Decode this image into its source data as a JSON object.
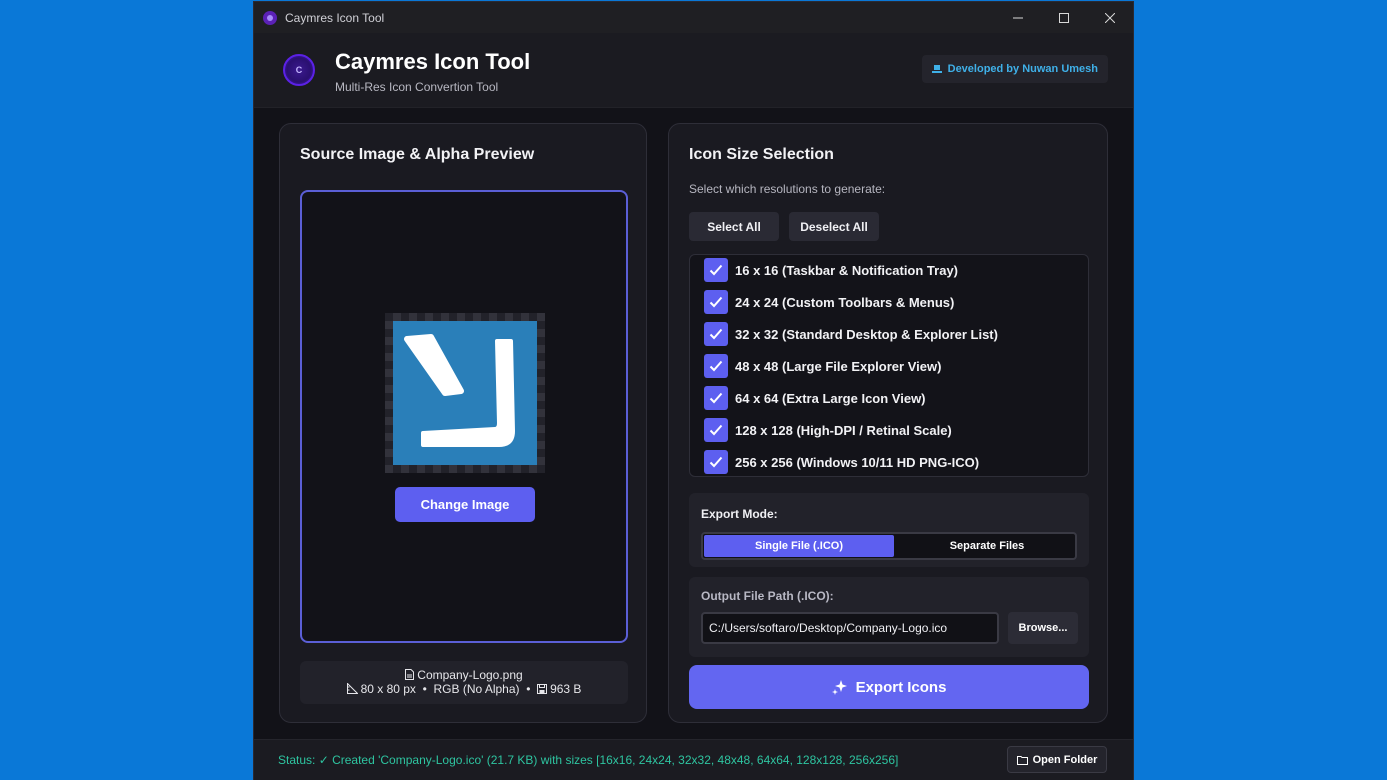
{
  "window": {
    "title": "Caymres Icon Tool"
  },
  "header": {
    "logo_letter": "C",
    "app_name": "Caymres Icon Tool",
    "subtitle": "Multi-Res Icon Convertion Tool",
    "developer_badge": "Developed by Nuwan Umesh"
  },
  "source_panel": {
    "title": "Source Image & Alpha Preview",
    "change_button": "Change Image",
    "file_name": "Company-Logo.png",
    "dimensions": "80 x 80 px",
    "color_mode": "RGB (No Alpha)",
    "file_size": "963 B",
    "separator": "•"
  },
  "size_panel": {
    "title": "Icon Size Selection",
    "hint": "Select which resolutions to generate:",
    "select_all": "Select All",
    "deselect_all": "Deselect All",
    "sizes": [
      {
        "label": "16 x 16 (Taskbar & Notification Tray)",
        "checked": true
      },
      {
        "label": "24 x 24 (Custom Toolbars & Menus)",
        "checked": true
      },
      {
        "label": "32 x 32 (Standard Desktop & Explorer List)",
        "checked": true
      },
      {
        "label": "48 x 48 (Large File Explorer View)",
        "checked": true
      },
      {
        "label": "64 x 64 (Extra Large Icon View)",
        "checked": true
      },
      {
        "label": "128 x 128 (High-DPI / Retinal Scale)",
        "checked": true
      },
      {
        "label": "256 x 256 (Windows 10/11 HD PNG-ICO)",
        "checked": true
      }
    ],
    "export_mode_label": "Export Mode:",
    "mode_single": "Single File (.ICO)",
    "mode_separate": "Separate Files",
    "selected_mode": "Single File (.ICO)",
    "output_label": "Output File Path (.ICO):",
    "output_path": "C:/Users/softaro/Desktop/Company-Logo.ico",
    "browse": "Browse...",
    "export_button": "Export Icons"
  },
  "statusbar": {
    "status": "Status: ✓ Created 'Company-Logo.ico' (21.7 KB) with sizes [16x16, 24x24, 32x32, 48x48, 64x64, 128x128, 256x256]",
    "open_folder": "Open Folder"
  },
  "colors": {
    "accent": "#6366f1",
    "status_green": "#2ec4a0",
    "badge_blue": "#3fb0e8",
    "desktop_blue": "#0a78d7"
  }
}
